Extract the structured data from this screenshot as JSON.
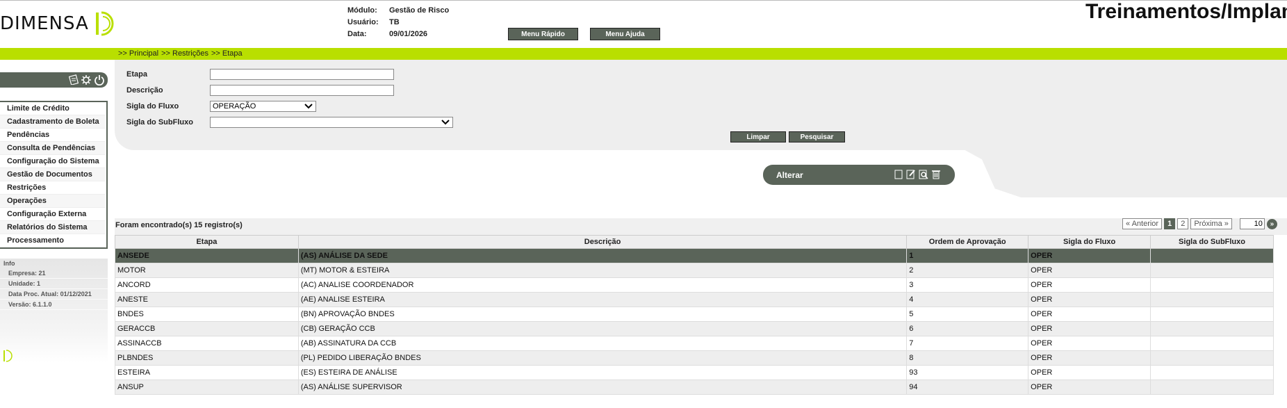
{
  "header": {
    "logo_text": "DIMENSA",
    "modulo_label": "Módulo:",
    "modulo_value": "Gestão de Risco",
    "usuario_label": "Usuário:",
    "usuario_value": "TB",
    "data_label": "Data:",
    "data_value": "09/01/2026",
    "menu_rapido": "Menu Rápido",
    "menu_ajuda": "Menu Ajuda",
    "page_title": "Treinamentos/Implanta"
  },
  "breadcrumb": [
    ">> Principal",
    ">> Restrições",
    ">> Etapa"
  ],
  "sidebar": {
    "items": [
      "Limite de Crédito",
      "Cadastramento de Boleta",
      "Pendências",
      "Consulta de Pendências",
      "Configuração do Sistema",
      "Gestão de Documentos",
      "Restrições",
      "Operações",
      "Configuração Externa",
      "Relatórios do Sistema",
      "Processamento"
    ],
    "info_title": "Info",
    "info": [
      "Empresa: 21",
      "Unidade: 1",
      "Data Proc. Atual: 01/12/2021",
      "Versão: 6.1.1.0"
    ]
  },
  "form": {
    "etapa_label": "Etapa",
    "etapa_value": "",
    "descricao_label": "Descrição",
    "descricao_value": "",
    "sigla_fluxo_label": "Sigla do Fluxo",
    "sigla_fluxo_value": "OPERAÇÃO",
    "sigla_subfluxo_label": "Sigla do SubFluxo",
    "sigla_subfluxo_value": "",
    "limpar": "Limpar",
    "pesquisar": "Pesquisar"
  },
  "actions": {
    "alterar": "Alterar",
    "icons": [
      "new-icon",
      "edit-icon",
      "view-icon",
      "delete-icon"
    ]
  },
  "results": {
    "summary": "Foram encontrado(s) 15 registro(s)",
    "prev": "« Anterior",
    "pages": [
      "1",
      "2"
    ],
    "current_page": "1",
    "next": "Próxima »",
    "page_size": "10",
    "go": "»"
  },
  "table": {
    "columns": [
      "Etapa",
      "Descrição",
      "Ordem de Aprovação",
      "Sigla do Fluxo",
      "Sigla do SubFluxo"
    ],
    "rows": [
      [
        "ANSEDE",
        "(AS) ANÁLISE DA SEDE",
        "1",
        "OPER",
        ""
      ],
      [
        "MOTOR",
        "(MT) MOTOR & ESTEIRA",
        "2",
        "OPER",
        ""
      ],
      [
        "ANCORD",
        "(AC) ANALISE COORDENADOR",
        "3",
        "OPER",
        ""
      ],
      [
        "ANESTE",
        "(AE) ANALISE ESTEIRA",
        "4",
        "OPER",
        ""
      ],
      [
        "BNDES",
        "(BN) APROVAÇÃO BNDES",
        "5",
        "OPER",
        ""
      ],
      [
        "GERACCB",
        "(CB) GERAÇÃO CCB",
        "6",
        "OPER",
        ""
      ],
      [
        "ASSINACCB",
        "(AB) ASSINATURA DA CCB",
        "7",
        "OPER",
        ""
      ],
      [
        "PLBNDES",
        "(PL) PEDIDO LIBERAÇÃO BNDES",
        "8",
        "OPER",
        ""
      ],
      [
        "ESTEIRA",
        "(ES) ESTEIRA DE ANÁLISE",
        "93",
        "OPER",
        ""
      ],
      [
        "ANSUP",
        "(AS) ANÁLISE SUPERVISOR",
        "94",
        "OPER",
        ""
      ]
    ],
    "selected_row": 0
  },
  "colors": {
    "accent_green": "#b9df00",
    "dark_gray": "#5a6459",
    "logo_green": "#b9df00"
  }
}
